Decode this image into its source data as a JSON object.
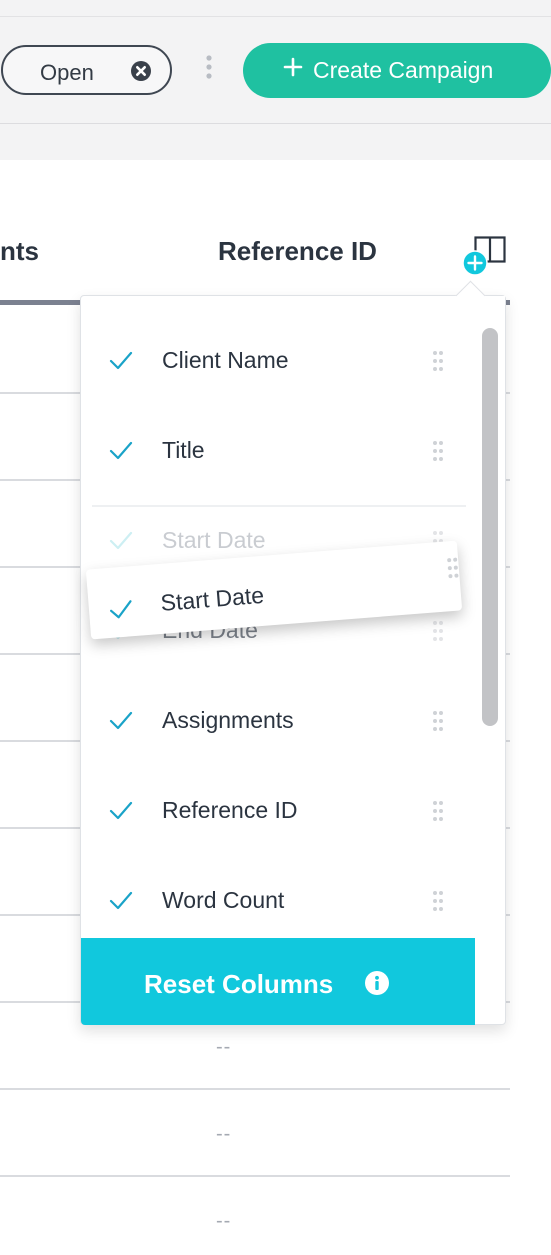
{
  "toolbar": {
    "filter_chip_label": "Open",
    "create_button_label": "Create Campaign",
    "accent_color": "#1fc1a1"
  },
  "table": {
    "headers": [
      "nts",
      "Reference ID"
    ],
    "empty_cell": "--"
  },
  "column_picker": {
    "items": [
      {
        "label": "Client Name",
        "checked": true
      },
      {
        "label": "Title",
        "checked": true
      },
      {
        "label": "Start Date",
        "checked": true,
        "state": "drop-placeholder"
      },
      {
        "label": "End Date",
        "checked": true,
        "state": "faded"
      },
      {
        "label": "Assignments",
        "checked": true
      },
      {
        "label": "Reference ID",
        "checked": true
      },
      {
        "label": "Word Count",
        "checked": true
      }
    ],
    "dragging_item": {
      "label": "Start Date",
      "checked": true
    },
    "reset_label": "Reset Columns",
    "accent_color": "#11c8dd",
    "check_color": "#1aa3c8"
  },
  "icons": {
    "chip_clear": "close-circle-icon",
    "more": "vertical-ellipsis-icon",
    "create": "plus-icon",
    "columns": "columns-icon",
    "add_column": "plus-circle-icon",
    "check": "check-icon",
    "grip": "drag-handle-icon",
    "info": "info-icon"
  }
}
